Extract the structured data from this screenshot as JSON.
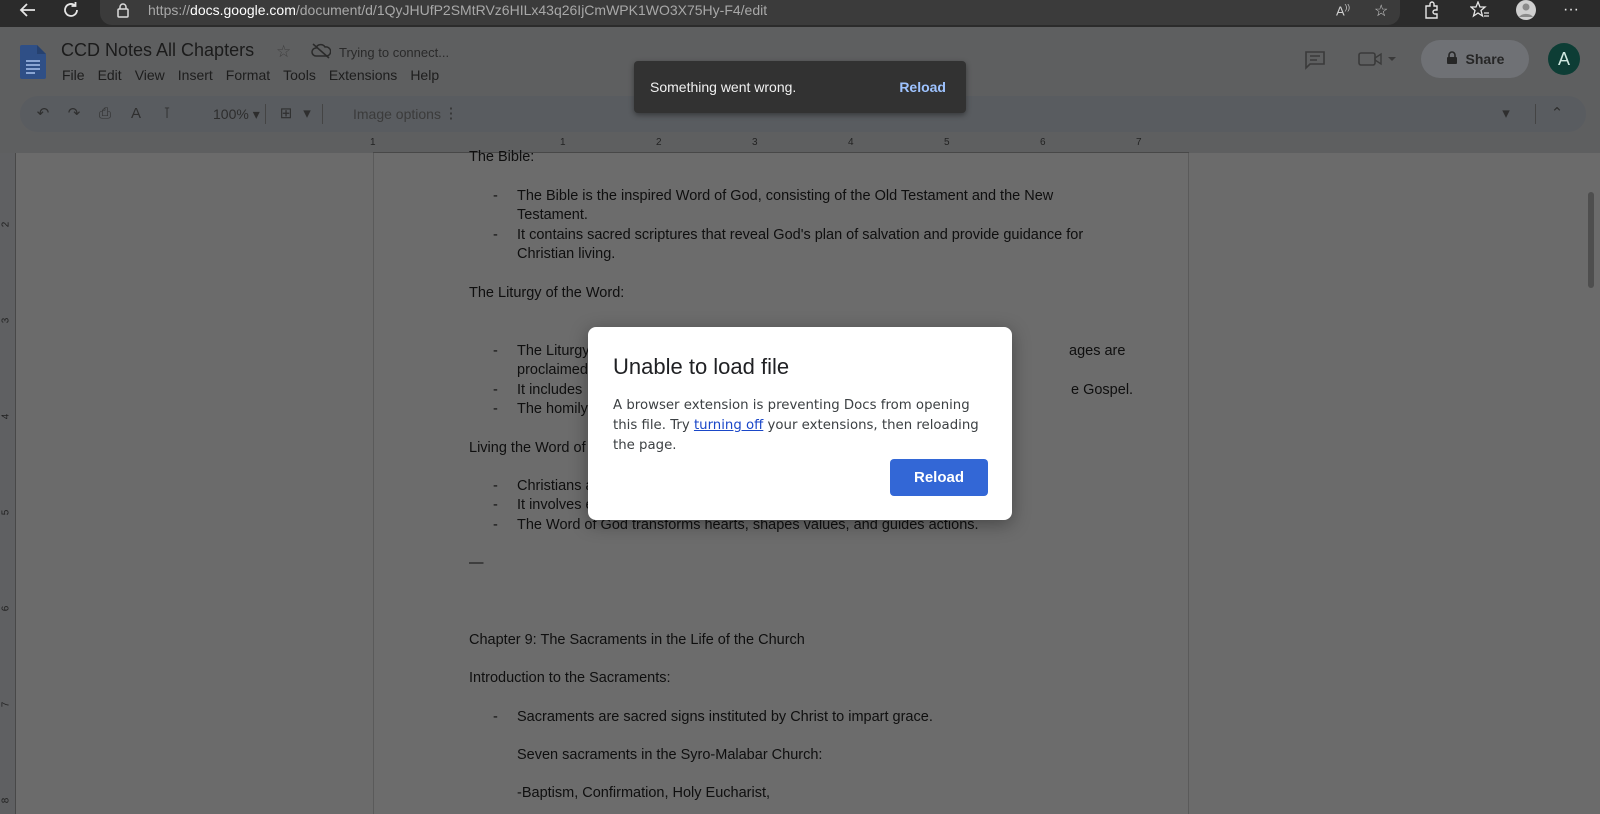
{
  "browser": {
    "url_prefix": "https://",
    "url_domain": "docs.google.com",
    "url_path": "/document/d/1QyJHUfP2SMtRVz6HILx43q26IjCmWPK1WO3X75Hy-F4/edit"
  },
  "docs": {
    "title": "CCD Notes All Chapters",
    "status": "Trying to connect...",
    "menu": [
      "File",
      "Edit",
      "View",
      "Insert",
      "Format",
      "Tools",
      "Extensions",
      "Help"
    ],
    "share_label": "Share",
    "avatar_letter": "A",
    "zoom": "100%",
    "image_options": "Image options"
  },
  "ruler": {
    "h_ticks": [
      "1",
      "1",
      "2",
      "3",
      "4",
      "5",
      "6",
      "7"
    ],
    "v_ticks": [
      "2",
      "3",
      "4",
      "5",
      "6",
      "7",
      "8"
    ]
  },
  "document": {
    "lines": [
      {
        "kind": "para",
        "text": "The Bible:"
      },
      {
        "kind": "bullet",
        "text": "The Bible is the inspired Word of God, consisting of the Old Testament and the New"
      },
      {
        "kind": "cont",
        "text": "Testament."
      },
      {
        "kind": "bullet",
        "text": "It contains sacred scriptures that reveal God's plan of salvation and provide guidance for"
      },
      {
        "kind": "cont",
        "text": "Christian living."
      },
      {
        "kind": "para",
        "text": "The Liturgy of the Word:"
      },
      {
        "kind": "bullet",
        "text": "The Liturgy"
      },
      {
        "kind": "cont",
        "text": "proclaimed"
      },
      {
        "kind": "bullet",
        "text": "It includes"
      },
      {
        "kind": "bullet",
        "text": "The homily"
      },
      {
        "kind": "para",
        "text": "Living the Word of"
      },
      {
        "kind": "bullet",
        "text": "Christians a"
      },
      {
        "kind": "bullet",
        "text": "It involves e"
      },
      {
        "kind": "bullet",
        "text": "The Word of God transforms hearts, shapes values, and guides actions."
      },
      {
        "kind": "para",
        "text": "—"
      },
      {
        "kind": "para",
        "text": "Chapter 9: The Sacraments in the Life of the Church"
      },
      {
        "kind": "para",
        "text": "Introduction to the Sacraments:"
      },
      {
        "kind": "bullet",
        "text": "Sacraments are sacred signs instituted by Christ to impart grace."
      },
      {
        "kind": "cont",
        "text": "Seven sacraments in the Syro-Malabar Church:"
      },
      {
        "kind": "cont",
        "text": "-Baptism, Confirmation, Holy Eucharist,"
      }
    ],
    "right_fragments": [
      "ages are",
      "e Gospel."
    ]
  },
  "toast": {
    "message": "Something went wrong.",
    "action": "Reload"
  },
  "modal": {
    "title": "Unable to load file",
    "body_before": "A browser extension is preventing Docs from opening this file. Try ",
    "body_link": "turning off",
    "body_after": " your extensions, then reloading the page.",
    "button": "Reload"
  },
  "colors": {
    "primary_button": "#3367d6",
    "toast_action": "#9ec3ff",
    "link": "#1a47c8"
  }
}
